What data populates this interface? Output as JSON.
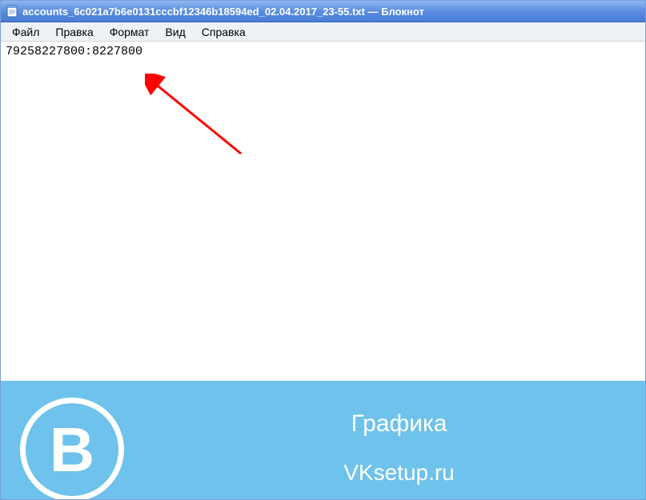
{
  "window": {
    "title": "accounts_6c021a7b6e0131cccbf12346b18594ed_02.04.2017_23-55.txt — Блокнот"
  },
  "menu": {
    "file": "Файл",
    "edit": "Правка",
    "format": "Формат",
    "view": "Вид",
    "help": "Справка"
  },
  "editor": {
    "content": "79258227800:8227800"
  },
  "banner": {
    "logo_letter": "В",
    "title": "Графика",
    "subtitle": "VKsetup.ru"
  },
  "colors": {
    "titlebar_start": "#8fb7f0",
    "titlebar_end": "#4a7ed6",
    "banner_bg": "#6ec2eb",
    "arrow": "#ff0000"
  }
}
